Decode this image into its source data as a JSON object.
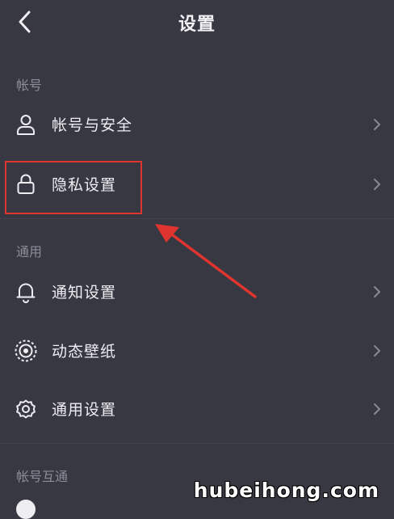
{
  "header": {
    "title": "设置"
  },
  "sections": [
    {
      "label": "帐号",
      "items": [
        {
          "label": "帐号与安全",
          "icon": "user-icon"
        },
        {
          "label": "隐私设置",
          "icon": "lock-icon"
        }
      ]
    },
    {
      "label": "通用",
      "items": [
        {
          "label": "通知设置",
          "icon": "bell-icon"
        },
        {
          "label": "动态壁纸",
          "icon": "concentric-circles-icon"
        },
        {
          "label": "通用设置",
          "icon": "gear-icon"
        }
      ]
    },
    {
      "label": "帐号互通",
      "items": []
    }
  ],
  "annotation": {
    "color": "#e0342f"
  },
  "watermark": "hubeihong.com",
  "colors": {
    "background": "#383843",
    "text": "#ededf2",
    "section_label": "#8d8d98",
    "chevron": "#8a8a94"
  }
}
